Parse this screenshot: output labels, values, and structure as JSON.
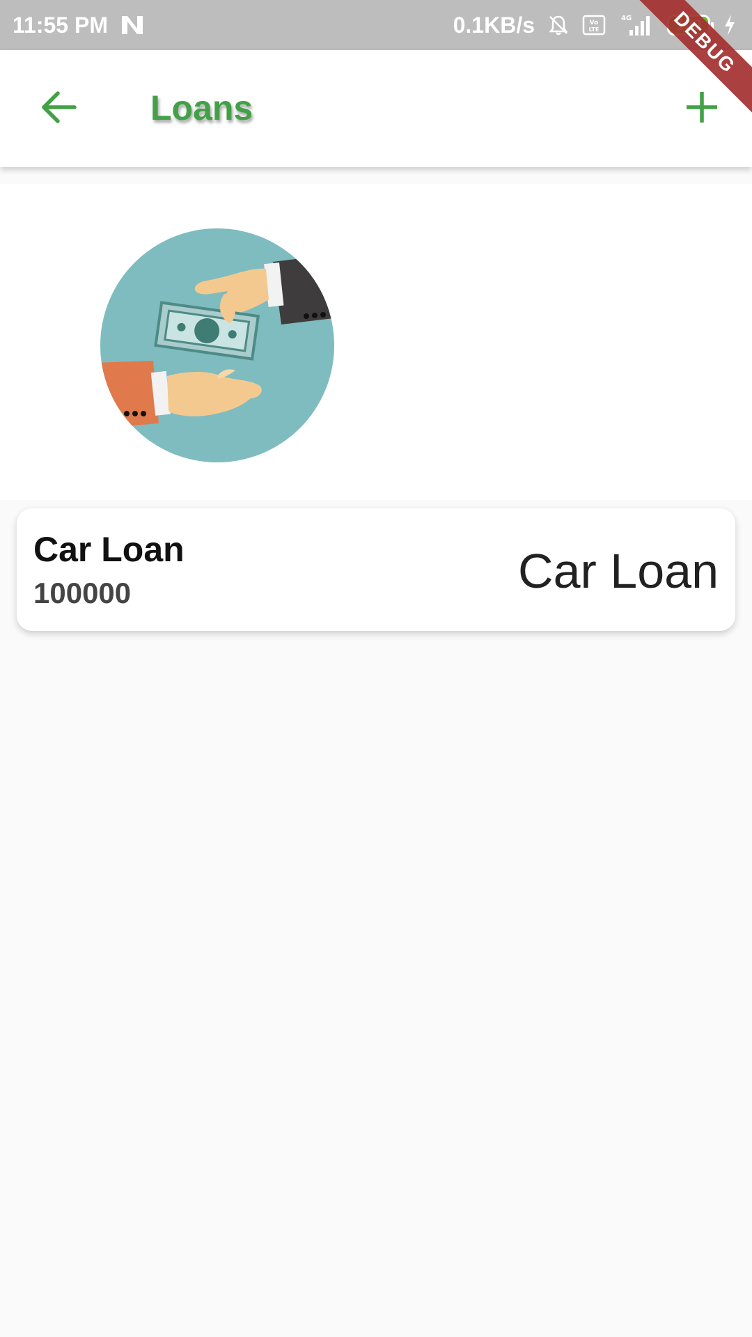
{
  "status_bar": {
    "time": "11:55 PM",
    "network_speed": "0.1KB/s",
    "network_type": "4G",
    "volte": "Vo LTE",
    "battery": "100",
    "icons": [
      "notification-n-icon",
      "mute-bell-icon",
      "volte-icon",
      "signal-icon",
      "battery-icon",
      "charging-icon"
    ]
  },
  "app_bar": {
    "title": "Loans",
    "back_icon": "arrow-back-icon",
    "add_icon": "plus-icon",
    "accent_color": "#43a047"
  },
  "debug_banner": "DEBUG",
  "hero": {
    "image": "money-exchange-hands-illustration",
    "circle_color": "#7fbcc0"
  },
  "loans": [
    {
      "name": "Car Loan",
      "amount": "100000",
      "type_label": "Car Loan"
    }
  ]
}
